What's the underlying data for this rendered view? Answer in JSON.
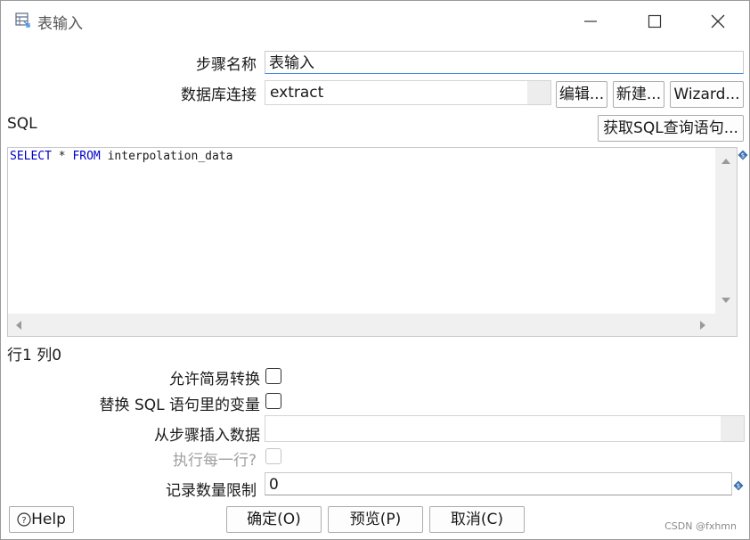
{
  "window": {
    "title": "表输入"
  },
  "form": {
    "step_name_label": "步骤名称",
    "step_name_value": "表输入",
    "db_conn_label": "数据库连接",
    "db_conn_value": "extract",
    "edit_button": "编辑...",
    "new_button": "新建...",
    "wizard_button": "Wizard...",
    "sql_label": "SQL",
    "get_sql_button": "获取SQL查询语句...",
    "sql_keyword_select": "SELECT",
    "sql_star": " * ",
    "sql_keyword_from": "FROM",
    "sql_table": " interpolation_data",
    "cursor_pos": "行1 列0",
    "lazy_conversion_label": "允许简易转换",
    "replace_vars_label": "替换 SQL 语句里的变量",
    "insert_from_step_label": "从步骤插入数据",
    "insert_from_step_value": "",
    "execute_each_row_label": "执行每一行?",
    "limit_label": "记录数量限制",
    "limit_value": "0"
  },
  "footer": {
    "help_button": "Help",
    "ok_button": "确定(O)",
    "preview_button": "预览(P)",
    "cancel_button": "取消(C)",
    "watermark": "CSDN @fxhmn"
  }
}
